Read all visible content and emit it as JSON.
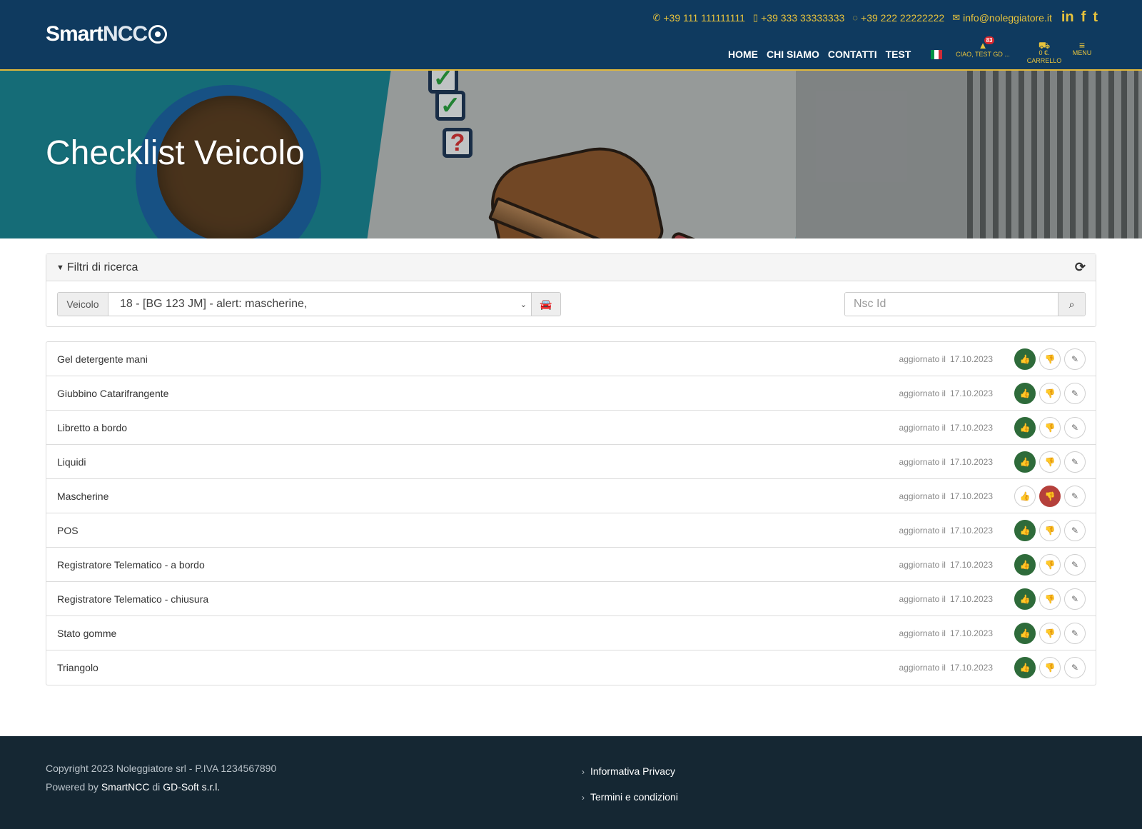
{
  "header": {
    "logo_smart": "Smart",
    "logo_ncc": "NCC",
    "phone": "+39 111 111111111",
    "mobile": "+39 333 33333333",
    "whatsapp": "+39 222 22222222",
    "email": "info@noleggiatore.it",
    "social": [
      "in",
      "f",
      "t"
    ],
    "nav": [
      "HOME",
      "CHI SIAMO",
      "CONTATTI",
      "TEST"
    ],
    "notifications_count": "83",
    "user_label": "CIAO, TEST GD ...",
    "cart_amount": "0 €.",
    "cart_label": "CARRELLO",
    "menu_label": "MENU"
  },
  "hero": {
    "title": "Checklist Veicolo"
  },
  "filters": {
    "title": "Filtri di ricerca",
    "vehicle_label": "Veicolo",
    "vehicle_selected": "18 - [BG 123 JM] - alert: mascherine,",
    "search_placeholder": "Nsc Id"
  },
  "checklist": {
    "updated_label": "aggiornato il",
    "items": [
      {
        "name": "Gel detergente mani",
        "date": "17.10.2023",
        "status": "ok"
      },
      {
        "name": "Giubbino Catarifrangente",
        "date": "17.10.2023",
        "status": "ok"
      },
      {
        "name": "Libretto a bordo",
        "date": "17.10.2023",
        "status": "ok"
      },
      {
        "name": "Liquidi",
        "date": "17.10.2023",
        "status": "ok"
      },
      {
        "name": "Mascherine",
        "date": "17.10.2023",
        "status": "ko"
      },
      {
        "name": "POS",
        "date": "17.10.2023",
        "status": "ok"
      },
      {
        "name": "Registratore Telematico - a bordo",
        "date": "17.10.2023",
        "status": "ok"
      },
      {
        "name": "Registratore Telematico - chiusura",
        "date": "17.10.2023",
        "status": "ok"
      },
      {
        "name": "Stato gomme",
        "date": "17.10.2023",
        "status": "ok"
      },
      {
        "name": "Triangolo",
        "date": "17.10.2023",
        "status": "ok"
      }
    ]
  },
  "footer": {
    "copyright": "Copyright 2023 Noleggiatore srl - P.IVA 1234567890",
    "powered_prefix": "Powered by",
    "powered_brand": "SmartNCC",
    "powered_mid": "di",
    "powered_company": "GD-Soft s.r.l.",
    "links": [
      "Informativa Privacy",
      "Termini e condizioni"
    ]
  },
  "colors": {
    "header_bg": "#0f3a5f",
    "accent": "#e8c33c",
    "ok": "#2e6b3a",
    "ko": "#b5403b",
    "footer_bg": "#152733"
  },
  "icons": {
    "phone": "phone-icon",
    "mobile": "mobile-icon",
    "whatsapp": "whatsapp-icon",
    "email": "envelope-icon",
    "bell": "bell-icon",
    "cart": "cart-icon",
    "menu": "bars-icon",
    "refresh": "refresh-icon",
    "car": "car-icon",
    "search": "search-icon",
    "thumbs_up": "thumbs-up-icon",
    "thumbs_down": "thumbs-down-icon",
    "edit": "pencil-icon"
  }
}
